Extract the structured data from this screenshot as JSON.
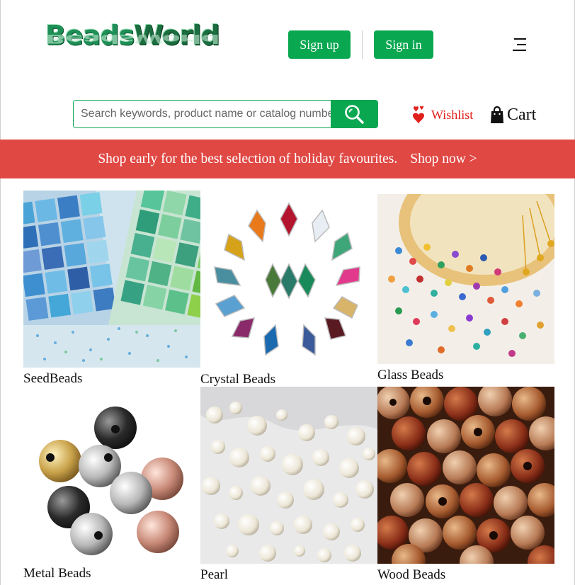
{
  "header": {
    "logo_part1": "Beads",
    "logo_part2": "World",
    "signup_label": "Sign up",
    "signin_label": "Sign in",
    "menu_icon": "hamburger-menu-icon"
  },
  "search": {
    "placeholder": "Search keywords, product name or catalog number",
    "value": "",
    "button_icon": "search-icon"
  },
  "actions": {
    "wishlist_label": "Wishlist",
    "wishlist_icon": "hearts-icon",
    "cart_label": "Cart",
    "cart_icon": "shopping-bag-icon"
  },
  "banner": {
    "message": "Shop early for the best selection of holiday favourites.",
    "link": "Shop now >"
  },
  "categories": [
    {
      "label": "SeedBeads"
    },
    {
      "label": "Crystal Beads"
    },
    {
      "label": "Glass Beads"
    },
    {
      "label": "Metal Beads"
    },
    {
      "label": "Pearl"
    },
    {
      "label": "Wood Beads"
    }
  ],
  "colors": {
    "brand_green": "#0aa751",
    "banner_red": "#e04844",
    "wishlist_red": "#e0201b"
  }
}
